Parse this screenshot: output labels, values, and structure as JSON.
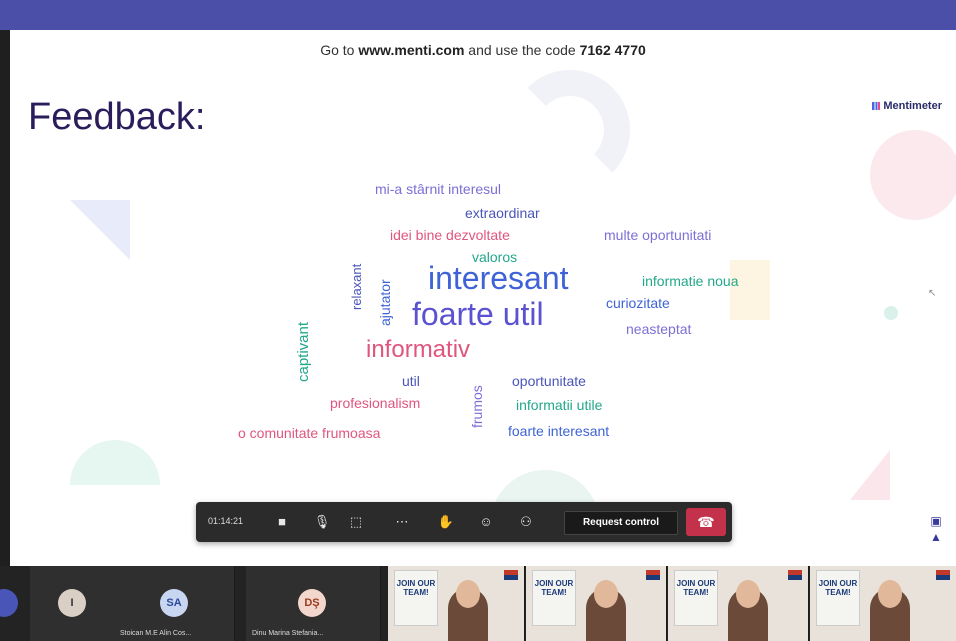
{
  "slide": {
    "menti_prefix": "Go to ",
    "menti_site": "www.menti.com",
    "menti_middle": " and use the code ",
    "menti_code": "7162 4770",
    "title": "Feedback:",
    "logo": "Mentimeter"
  },
  "words": [
    {
      "text": "mi-a stârnit interesul",
      "color": "#7b6fd6"
    },
    {
      "text": "extraordinar",
      "color": "#4a55b8"
    },
    {
      "text": "idei bine dezvoltate",
      "color": "#e0557e"
    },
    {
      "text": "multe oportunitati",
      "color": "#7b6fd6"
    },
    {
      "text": "valoros",
      "color": "#22a88a"
    },
    {
      "text": "interesant",
      "color": "#3f63d6"
    },
    {
      "text": "relaxant",
      "color": "#4a55b8"
    },
    {
      "text": "ajutator",
      "color": "#3f63d6"
    },
    {
      "text": "informatie noua",
      "color": "#22a88a"
    },
    {
      "text": "curiozitate",
      "color": "#3f63d6"
    },
    {
      "text": "foarte util",
      "color": "#5a52d0"
    },
    {
      "text": "neasteptat",
      "color": "#7b6fd6"
    },
    {
      "text": "captivant",
      "color": "#22a88a"
    },
    {
      "text": "informativ",
      "color": "#e0557e"
    },
    {
      "text": "util",
      "color": "#4a55b8"
    },
    {
      "text": "frumos",
      "color": "#7b6fd6"
    },
    {
      "text": "oportunitate",
      "color": "#4a55b8"
    },
    {
      "text": "profesionalism",
      "color": "#e0557e"
    },
    {
      "text": "informatii utile",
      "color": "#22a88a"
    },
    {
      "text": "o comunitate frumoasa",
      "color": "#e0557e"
    },
    {
      "text": "foarte interesant",
      "color": "#3f63d6"
    }
  ],
  "callbar": {
    "timer": "01:14:21",
    "request_control": "Request control",
    "icons": [
      "camera-icon",
      "microphone-icon",
      "share-screen-icon",
      "more-icon",
      "raise-hand-icon",
      "reactions-icon",
      "participants-icon",
      "hang-up-icon"
    ]
  },
  "participants": [
    {
      "initials": "I",
      "name": "",
      "bg": "#d9cfc4",
      "fg": "#333"
    },
    {
      "initials": "SA",
      "name": "Stoican M.E Alin Cos...",
      "bg": "#c9d6f2",
      "fg": "#2b4a9a"
    },
    {
      "initials": "DŞ",
      "name": "Dinu Marina Stefania...",
      "bg": "#f4d7cc",
      "fg": "#9a3a22"
    }
  ],
  "videos": [
    {
      "poster": "JOIN OUR TEAM!"
    },
    {
      "poster": "JOIN OUR TEAM!"
    },
    {
      "poster": "JOIN OUR TEAM!"
    },
    {
      "poster": "JOIN OUR TEAM!"
    }
  ],
  "colors": {
    "topbar": "#4b4fa8",
    "title": "#2b1d5c",
    "hangup": "#c4314b"
  }
}
